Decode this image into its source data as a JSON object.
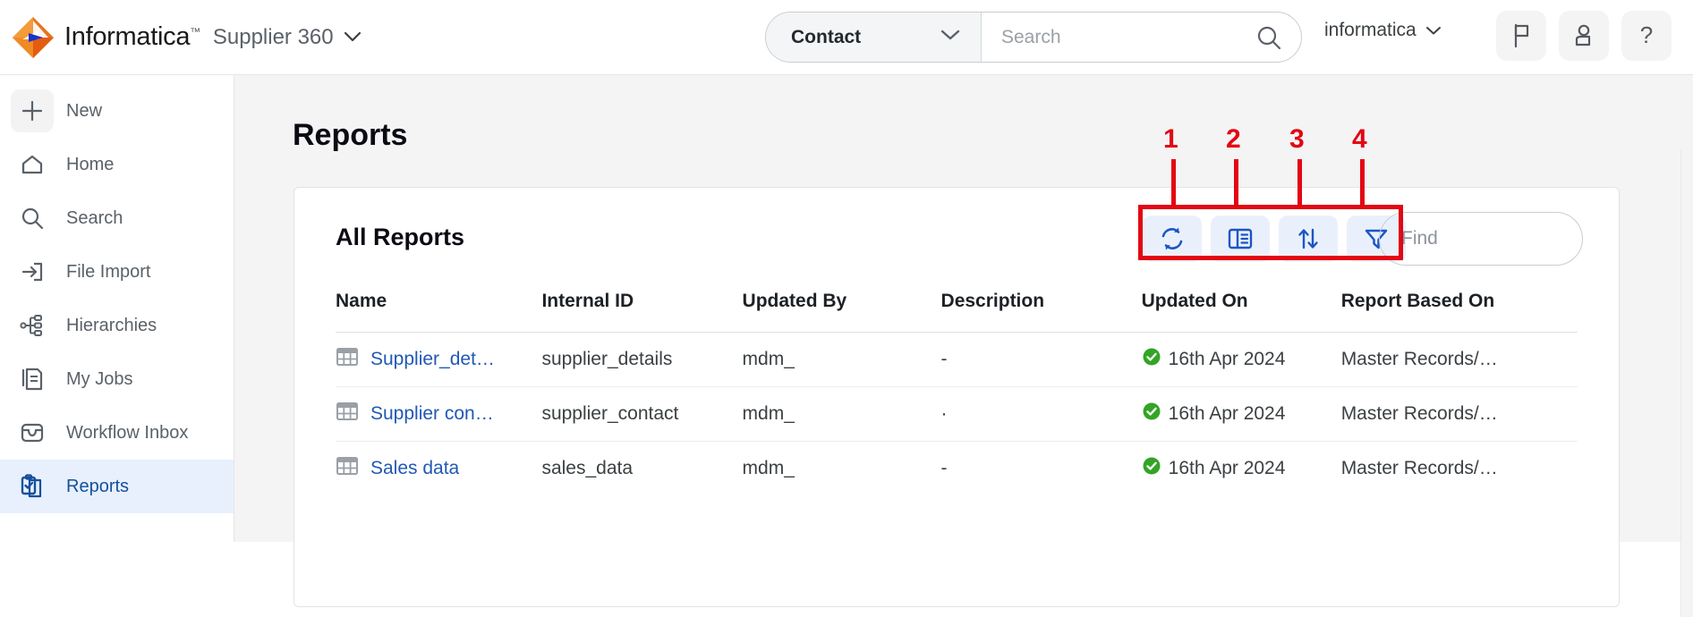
{
  "header": {
    "brand": "Informatica",
    "brand_tm": "™",
    "app_name": "Supplier 360",
    "app_chevron_icon": "chevron-down-icon",
    "search": {
      "entity_label": "Contact",
      "entity_chevron_icon": "chevron-down-icon",
      "placeholder": "Search",
      "value": "",
      "search_icon": "search-icon"
    },
    "account_name": "informatica",
    "account_chevron_icon": "chevron-down-icon",
    "icon_buttons": [
      {
        "name": "flag-icon",
        "label": "Flag"
      },
      {
        "name": "user-icon",
        "label": "User"
      },
      {
        "name": "help-icon",
        "label": "?"
      }
    ]
  },
  "sidebar": {
    "items": [
      {
        "label": "New",
        "icon": "plus-icon",
        "active": false
      },
      {
        "label": "Home",
        "icon": "home-icon",
        "active": false
      },
      {
        "label": "Search",
        "icon": "search-icon",
        "active": false
      },
      {
        "label": "File Import",
        "icon": "file-import-icon",
        "active": false
      },
      {
        "label": "Hierarchies",
        "icon": "hierarchies-icon",
        "active": false
      },
      {
        "label": "My Jobs",
        "icon": "my-jobs-icon",
        "active": false
      },
      {
        "label": "Workflow Inbox",
        "icon": "workflow-inbox-icon",
        "active": false
      },
      {
        "label": "Reports",
        "icon": "reports-clipboard-icon",
        "active": true
      }
    ]
  },
  "main": {
    "page_title": "Reports",
    "card_title": "All Reports",
    "toolbar": [
      {
        "name": "refresh-icon",
        "label": "Refresh"
      },
      {
        "name": "columns-icon",
        "label": "Columns"
      },
      {
        "name": "sort-icon",
        "label": "Sort"
      },
      {
        "name": "filter-icon",
        "label": "Filter"
      }
    ],
    "find": {
      "placeholder": "Find",
      "value": ""
    },
    "annotations": [
      {
        "number": "1"
      },
      {
        "number": "2"
      },
      {
        "number": "3"
      },
      {
        "number": "4"
      }
    ],
    "table": {
      "columns": [
        "Name",
        "Internal ID",
        "Updated By",
        "Description",
        "Updated On",
        "Report Based On"
      ],
      "rows": [
        {
          "name": "Supplier_det…",
          "internal_id": "supplier_details",
          "updated_by": "mdm_",
          "description": "-",
          "updated_on": "16th Apr 2024",
          "status_icon": "check-circle-icon",
          "report_based_on": "Master Records/…"
        },
        {
          "name": "Supplier con…",
          "internal_id": "supplier_contact",
          "updated_by": "mdm_",
          "description": "·",
          "updated_on": "16th Apr 2024",
          "status_icon": "check-circle-icon",
          "report_based_on": "Master Records/…"
        },
        {
          "name": "Sales data",
          "internal_id": "sales_data",
          "updated_by": "mdm_",
          "description": "-",
          "updated_on": "16th Apr 2024",
          "status_icon": "check-circle-icon",
          "report_based_on": "Master Records/…"
        }
      ]
    }
  },
  "colors": {
    "brand_orange": "#E8741C",
    "brand_blue": "#1A32C8",
    "accent_blue": "#2158b5",
    "active_nav_bg": "#e8f0fd",
    "annotation_red": "#e30613",
    "status_green": "#34a426"
  }
}
